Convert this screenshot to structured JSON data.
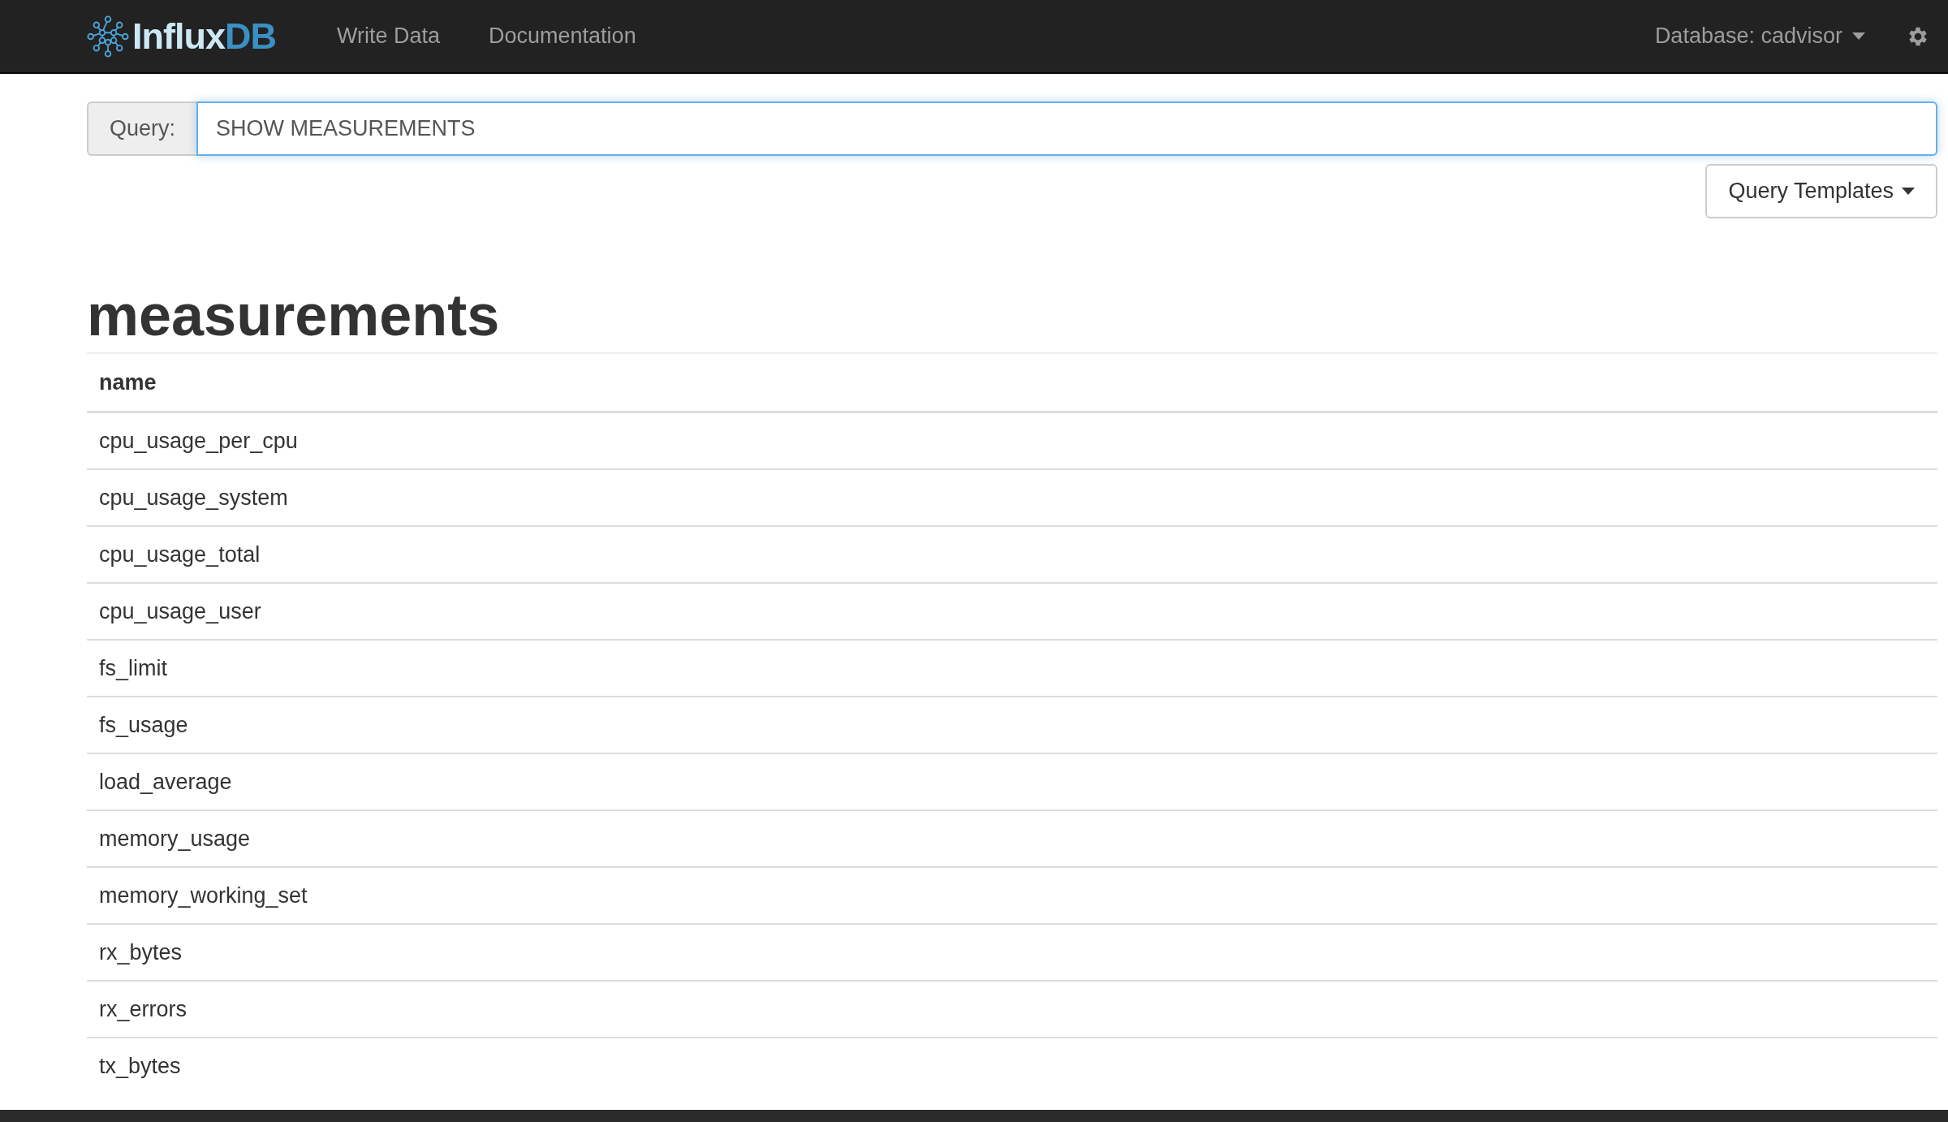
{
  "navbar": {
    "brand": {
      "part_1": "Influx",
      "part_2": "DB"
    },
    "links": [
      "Write Data",
      "Documentation"
    ],
    "database": "Database: cadvisor"
  },
  "query": {
    "label": "Query:",
    "value": "SHOW MEASUREMENTS",
    "templates_button": "Query Templates"
  },
  "result": {
    "title": "measurements",
    "columns": [
      "name"
    ],
    "rows": [
      "cpu_usage_per_cpu",
      "cpu_usage_system",
      "cpu_usage_total",
      "cpu_usage_user",
      "fs_limit",
      "fs_usage",
      "load_average",
      "memory_usage",
      "memory_working_set",
      "rx_bytes",
      "rx_errors",
      "tx_bytes"
    ]
  }
}
